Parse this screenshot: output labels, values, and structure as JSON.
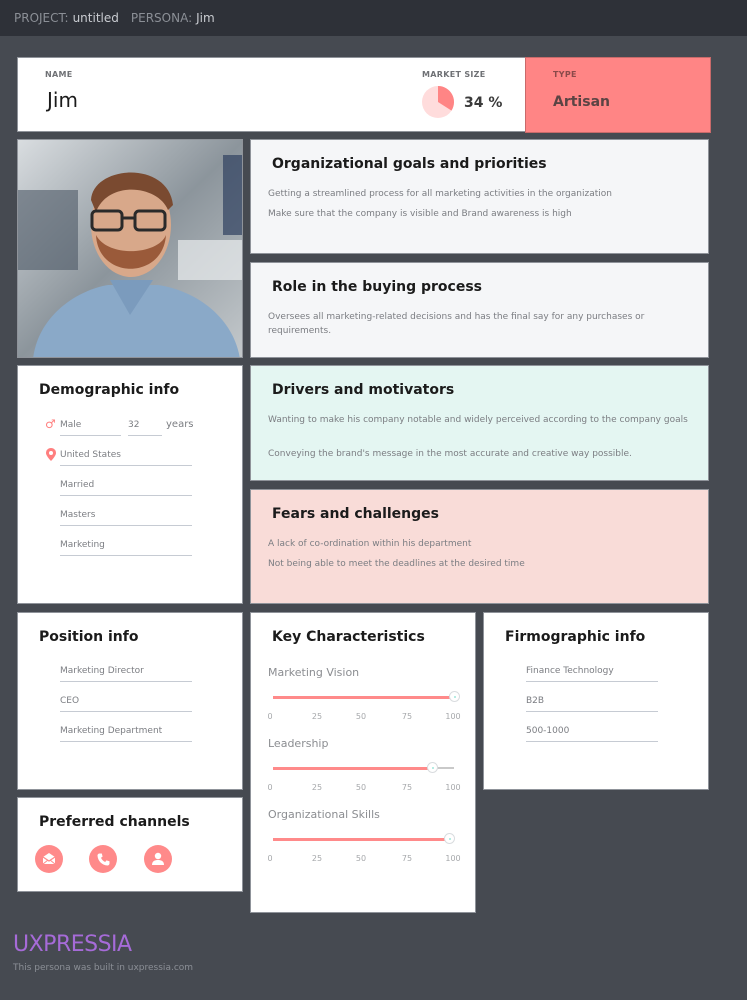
{
  "topbar": {
    "project_label": "PROJECT:",
    "project_value": "untitled",
    "persona_label": "PERSONA:",
    "persona_value": "Jim"
  },
  "header": {
    "name_label": "NAME",
    "name_value": "Jim",
    "market_size_label": "MARKET SIZE",
    "market_size_percent": 34,
    "market_size_text": "34 %",
    "type_label": "TYPE",
    "type_value": "Artisan"
  },
  "colors": {
    "accent": "#ff8585",
    "type_bg": "#ff8585",
    "drivers_bg": "#e4f6f2",
    "fears_bg": "#f9dcd8",
    "goals_bg": "#f5f6f8",
    "page_bg": "#464a51",
    "brand": "#a66bd8"
  },
  "photo": {
    "alt": "Portrait of Jim"
  },
  "goals": {
    "title": "Organizational goals and priorities",
    "items": [
      "Getting a streamlined process for all marketing activities in the organization",
      "Make sure that the company is visible and Brand awareness is high"
    ]
  },
  "role": {
    "title": "Role in the buying process",
    "items": [
      "Oversees all marketing-related decisions and has the final say for any purchases or requirements."
    ]
  },
  "drivers": {
    "title": "Drivers and motivators",
    "items": [
      "Wanting to make his company notable and widely perceived according to the company goals",
      "Conveying the brand's message in the most accurate and creative way possible."
    ]
  },
  "fears": {
    "title": "Fears and challenges",
    "items": [
      "A lack of co-ordination within his department",
      "Not being able to meet the deadlines at the desired time"
    ]
  },
  "demographic": {
    "title": "Demographic info",
    "gender": "Male",
    "age": "32",
    "age_unit": "years",
    "location": "United States",
    "marital_status": "Married",
    "education": "Masters",
    "field": "Marketing"
  },
  "position": {
    "title": "Position info",
    "items": [
      "Marketing Director",
      "CEO",
      "Marketing Department"
    ]
  },
  "key_characteristics": {
    "title": "Key Characteristics",
    "tick_labels": [
      "0",
      "25",
      "50",
      "75",
      "100"
    ],
    "sliders": [
      {
        "label": "Marketing Vision",
        "value": 100
      },
      {
        "label": "Leadership",
        "value": 88
      },
      {
        "label": "Organizational Skills",
        "value": 97
      }
    ]
  },
  "firmographic": {
    "title": "Firmographic info",
    "items": [
      "Finance Technology",
      "B2B",
      "500-1000"
    ]
  },
  "channels": {
    "title": "Preferred channels",
    "items": [
      {
        "icon": "email-icon"
      },
      {
        "icon": "phone-icon"
      },
      {
        "icon": "person-icon"
      }
    ]
  },
  "footer": {
    "brand": "UXPRESSIA",
    "note": "This persona was built in uxpressia.com"
  }
}
